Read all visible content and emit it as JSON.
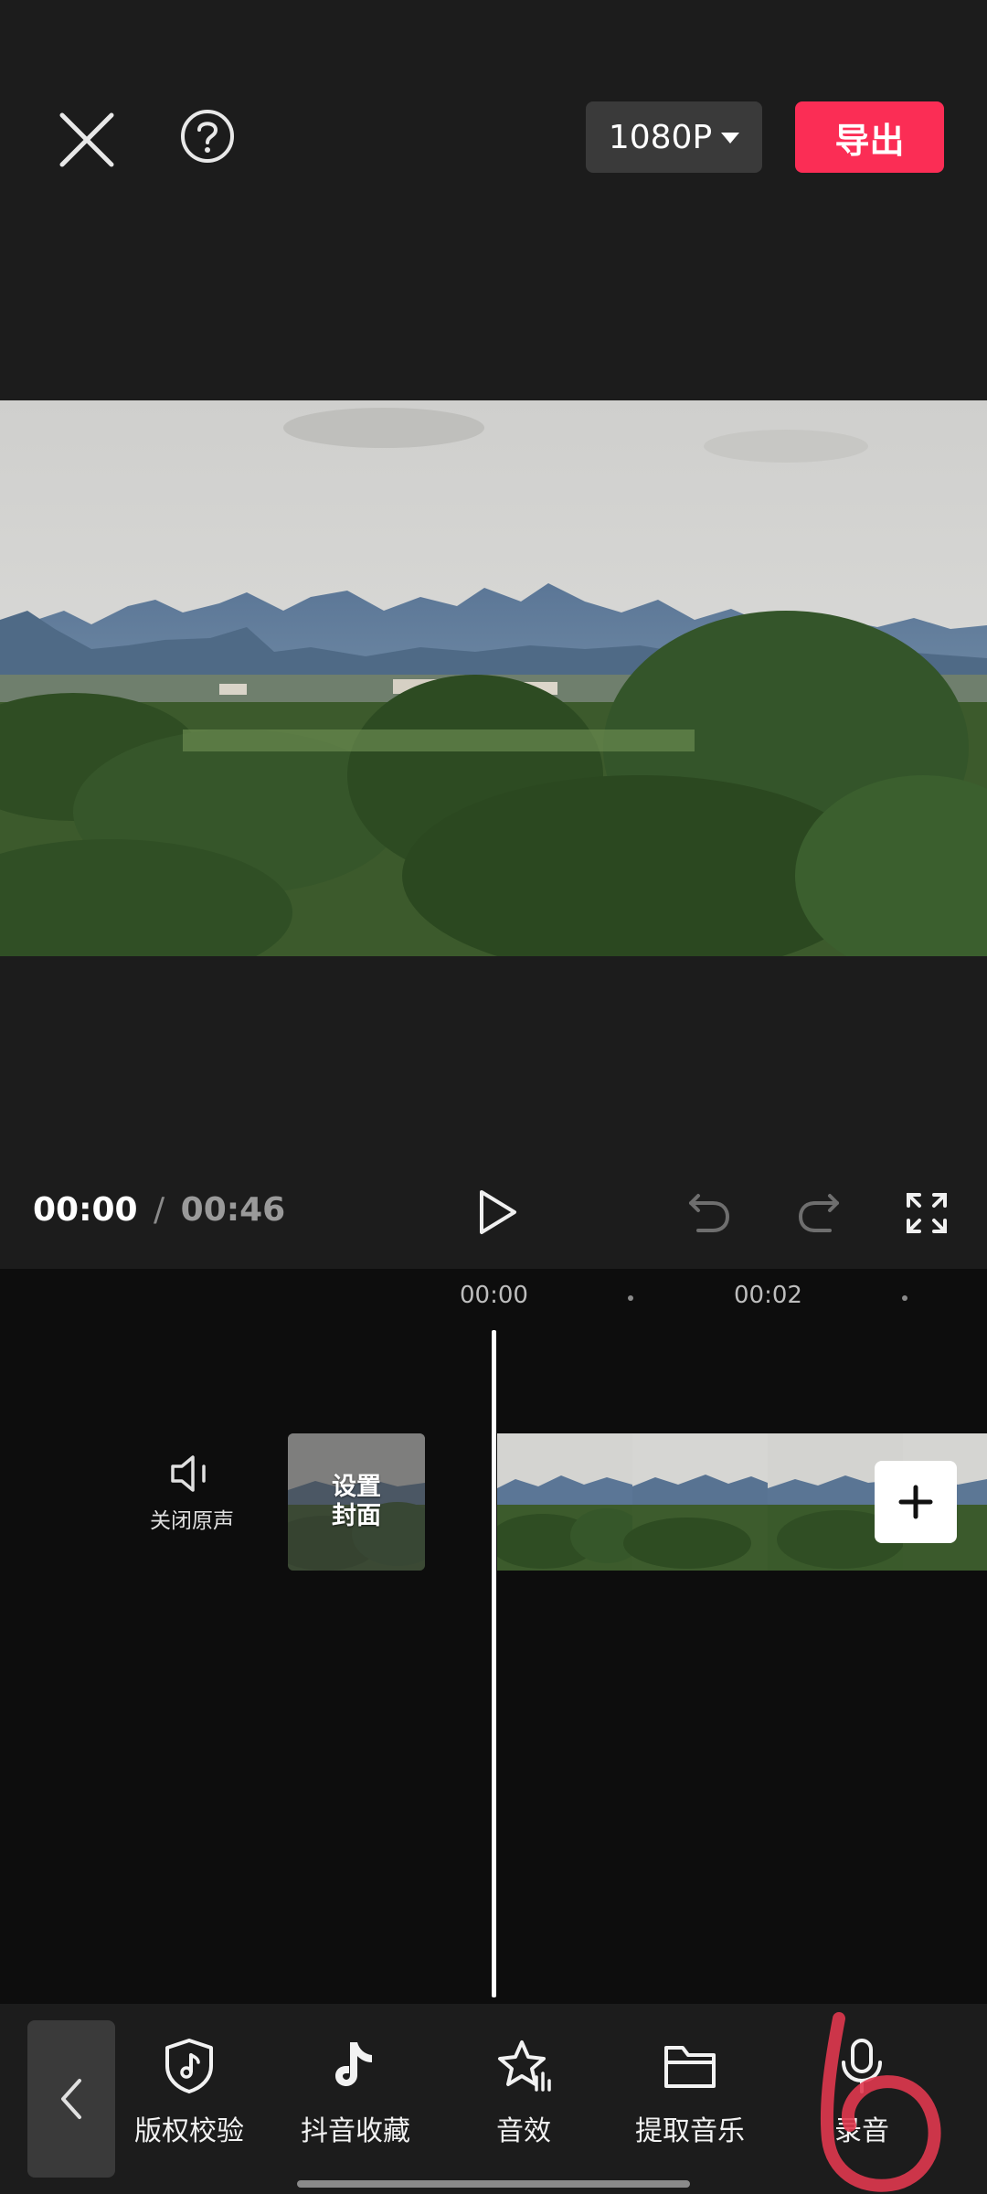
{
  "header": {
    "resolution_label": "1080P",
    "export_label": "导出",
    "accent_color": "#fb2d55"
  },
  "playback": {
    "current_time": "00:00",
    "separator": "/",
    "total_time": "00:46"
  },
  "timeline": {
    "ruler": [
      "00:00",
      "00:02"
    ],
    "mute_label": "关闭原声",
    "cover_label": "设置封面"
  },
  "toolbar": {
    "items": [
      {
        "label": "版权校验",
        "icon": "shield-music-icon"
      },
      {
        "label": "抖音收藏",
        "icon": "tiktok-icon"
      },
      {
        "label": "音效",
        "icon": "star-sound-icon"
      },
      {
        "label": "提取音乐",
        "icon": "folder-icon"
      },
      {
        "label": "录音",
        "icon": "microphone-icon"
      }
    ]
  }
}
